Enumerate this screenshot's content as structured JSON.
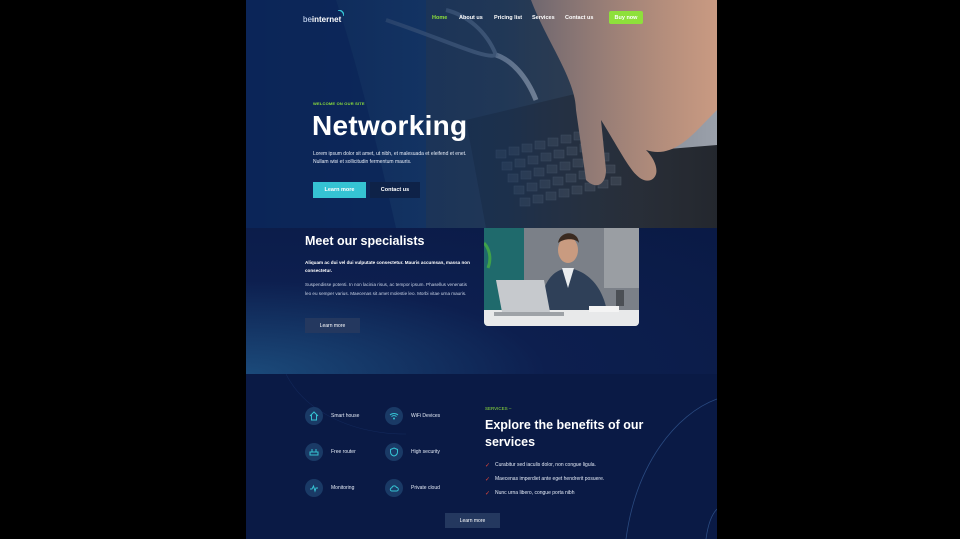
{
  "nav": {
    "logo_light": "be",
    "logo_bold": "internet",
    "links": [
      "Home",
      "About us",
      "Pricing list",
      "Services",
      "Contact us"
    ],
    "cta": "Buy now"
  },
  "hero": {
    "eyebrow": "WELCOME ON OUR SITE",
    "title": "Networking",
    "text": "Lorem ipsum dolor sit amet, ut nibh, et malesuada et eleifend et enet. Nullam wisi et sollicitudin fermentum mauris.",
    "primary_btn": "Learn more",
    "secondary_btn": "Contact us"
  },
  "specialists": {
    "title": "Meet our specialists",
    "bold_text": "Aliquam ac dui vel dui vulputate consectetur. Mauris accumsan, massa non consectetur.",
    "text": "Suspendisse potenti. In non lacinia risus, ac tempor ipsum. Phasellus venenatis leo eu semper varius. Maecenas sit amet molestie leo. Morbi vitae urna mauris.",
    "button": "Learn more"
  },
  "services": {
    "features": [
      {
        "label": "Smart house",
        "icon": "smart-house-icon"
      },
      {
        "label": "WiFi Devices",
        "icon": "wifi-devices-icon"
      },
      {
        "label": "Free router",
        "icon": "router-icon"
      },
      {
        "label": "High security",
        "icon": "security-icon"
      },
      {
        "label": "Monitoring",
        "icon": "monitoring-icon"
      },
      {
        "label": "Private cloud",
        "icon": "cloud-icon"
      }
    ],
    "eyebrow": "SERVICES –",
    "title": "Explore the benefits of our services",
    "list": [
      "Curabitur sed iaculis dolor, non congue ligula.",
      "Maecenas imperdiet ante eget hendrerit posuere.",
      "Nunc urna libero, congue porta nibh"
    ],
    "button": "Learn more"
  },
  "colors": {
    "accent_green": "#8ee03b",
    "accent_cyan": "#35c3d3",
    "navy": "#0a1a45",
    "check_red": "#e5473b"
  }
}
